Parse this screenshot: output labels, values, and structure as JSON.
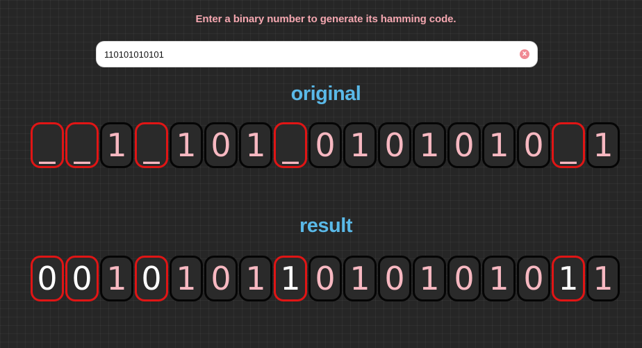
{
  "instruction": "Enter a binary number to generate its hamming code.",
  "input": {
    "value": "110101010101",
    "clear_symbol": "x"
  },
  "original": {
    "title": "original",
    "bits": [
      {
        "v": "_",
        "parity": true
      },
      {
        "v": "_",
        "parity": true
      },
      {
        "v": "1",
        "parity": false
      },
      {
        "v": "_",
        "parity": true
      },
      {
        "v": "1",
        "parity": false
      },
      {
        "v": "0",
        "parity": false
      },
      {
        "v": "1",
        "parity": false
      },
      {
        "v": "_",
        "parity": true
      },
      {
        "v": "0",
        "parity": false
      },
      {
        "v": "1",
        "parity": false
      },
      {
        "v": "0",
        "parity": false
      },
      {
        "v": "1",
        "parity": false
      },
      {
        "v": "0",
        "parity": false
      },
      {
        "v": "1",
        "parity": false
      },
      {
        "v": "0",
        "parity": false
      },
      {
        "v": "_",
        "parity": true
      },
      {
        "v": "1",
        "parity": false
      }
    ]
  },
  "result": {
    "title": "result",
    "bits": [
      {
        "v": "0",
        "parity": true
      },
      {
        "v": "0",
        "parity": true
      },
      {
        "v": "1",
        "parity": false
      },
      {
        "v": "0",
        "parity": true
      },
      {
        "v": "1",
        "parity": false
      },
      {
        "v": "0",
        "parity": false
      },
      {
        "v": "1",
        "parity": false
      },
      {
        "v": "1",
        "parity": true
      },
      {
        "v": "0",
        "parity": false
      },
      {
        "v": "1",
        "parity": false
      },
      {
        "v": "0",
        "parity": false
      },
      {
        "v": "1",
        "parity": false
      },
      {
        "v": "0",
        "parity": false
      },
      {
        "v": "1",
        "parity": false
      },
      {
        "v": "0",
        "parity": false
      },
      {
        "v": "1",
        "parity": true
      },
      {
        "v": "1",
        "parity": false
      }
    ]
  },
  "colors": {
    "background": "#262626",
    "instruction": "#f4a7b0",
    "title": "#5ab9e8",
    "data_bit_text": "#f7b8c1",
    "parity_border": "#e01515",
    "bit_border": "#050505"
  }
}
